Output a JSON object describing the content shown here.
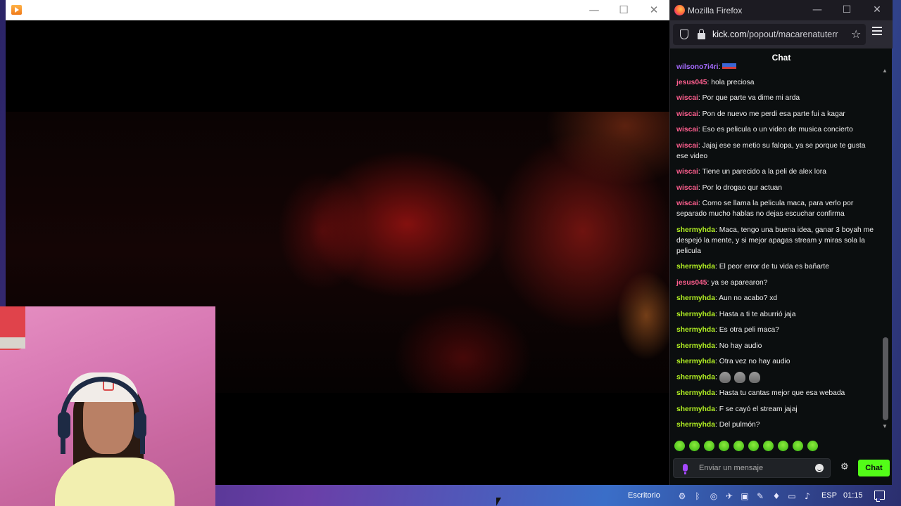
{
  "player": {
    "title": "",
    "controls": {
      "minimize": "—",
      "maximize": "☐",
      "close": "✕"
    }
  },
  "firefox": {
    "title": "Mozilla Firefox",
    "controls": {
      "minimize": "—",
      "maximize": "☐",
      "close": "✕"
    },
    "url_domain": "kick.com",
    "url_path": "/popout/macarenatuterr",
    "star_icon": "☆"
  },
  "chat": {
    "header": "Chat",
    "partial_top_user": "wilsono7i4ri",
    "messages": [
      {
        "user": "jesus045",
        "color": "pink",
        "text": "hola preciosa"
      },
      {
        "user": "wiscai",
        "color": "pink",
        "text": "Por que parte va dime mi arda"
      },
      {
        "user": "wiscai",
        "color": "pink",
        "text": "Pon de nuevo me perdi esa parte fui a kagar"
      },
      {
        "user": "wiscai",
        "color": "pink",
        "text": "Eso es pelicula o un video de musica concierto"
      },
      {
        "user": "wiscai",
        "color": "pink",
        "text": "Jajaj ese se metio su falopa, ya se porque te gusta ese video"
      },
      {
        "user": "wiscai",
        "color": "pink",
        "text": "Tiene un parecido a la peli de alex lora"
      },
      {
        "user": "wiscai",
        "color": "pink",
        "text": "Por lo drogao qur actuan"
      },
      {
        "user": "wiscai",
        "color": "pink",
        "text": "Como se llama la pelicula maca, para verlo por separado mucho hablas no dejas escuchar confirma"
      },
      {
        "user": "shermyhda",
        "color": "lime",
        "text": "Maca, tengo una buena idea, ganar 3 boyah me despejó la mente, y si mejor apagas stream y miras sola la pelicula"
      },
      {
        "user": "shermyhda",
        "color": "lime",
        "text": "El peor error de tu vida es bañarte"
      },
      {
        "user": "jesus045",
        "color": "pink",
        "text": "ya se aparearon?"
      },
      {
        "user": "shermyhda",
        "color": "lime",
        "text": "Aun no acabo? xd"
      },
      {
        "user": "shermyhda",
        "color": "lime",
        "text": "Hasta a ti te aburrió jaja"
      },
      {
        "user": "shermyhda",
        "color": "lime",
        "text": "Es otra peli maca?"
      },
      {
        "user": "shermyhda",
        "color": "lime",
        "text": "No hay audio"
      },
      {
        "user": "shermyhda",
        "color": "lime",
        "text": "Otra vez no hay audio"
      },
      {
        "user": "shermyhda",
        "color": "lime",
        "text": ""
      },
      {
        "user": "shermyhda",
        "color": "lime",
        "text": "Hasta tu cantas mejor que esa webada"
      },
      {
        "user": "shermyhda",
        "color": "lime",
        "text": "F se cayó el stream jajaj"
      },
      {
        "user": "shermyhda",
        "color": "lime",
        "text": "Del pulmón?"
      }
    ],
    "input_placeholder": "Enviar un mensaje",
    "send_label": "Chat",
    "gear_icon": "⚙"
  },
  "taskbar": {
    "desktop_label": "Escritorio",
    "language": "ESP",
    "time": "01:15"
  },
  "colors": {
    "kick_green": "#53fc18",
    "chat_bg": "#0b0e0f",
    "user_pink": "#ff5f8f",
    "user_lime": "#b4f224"
  }
}
